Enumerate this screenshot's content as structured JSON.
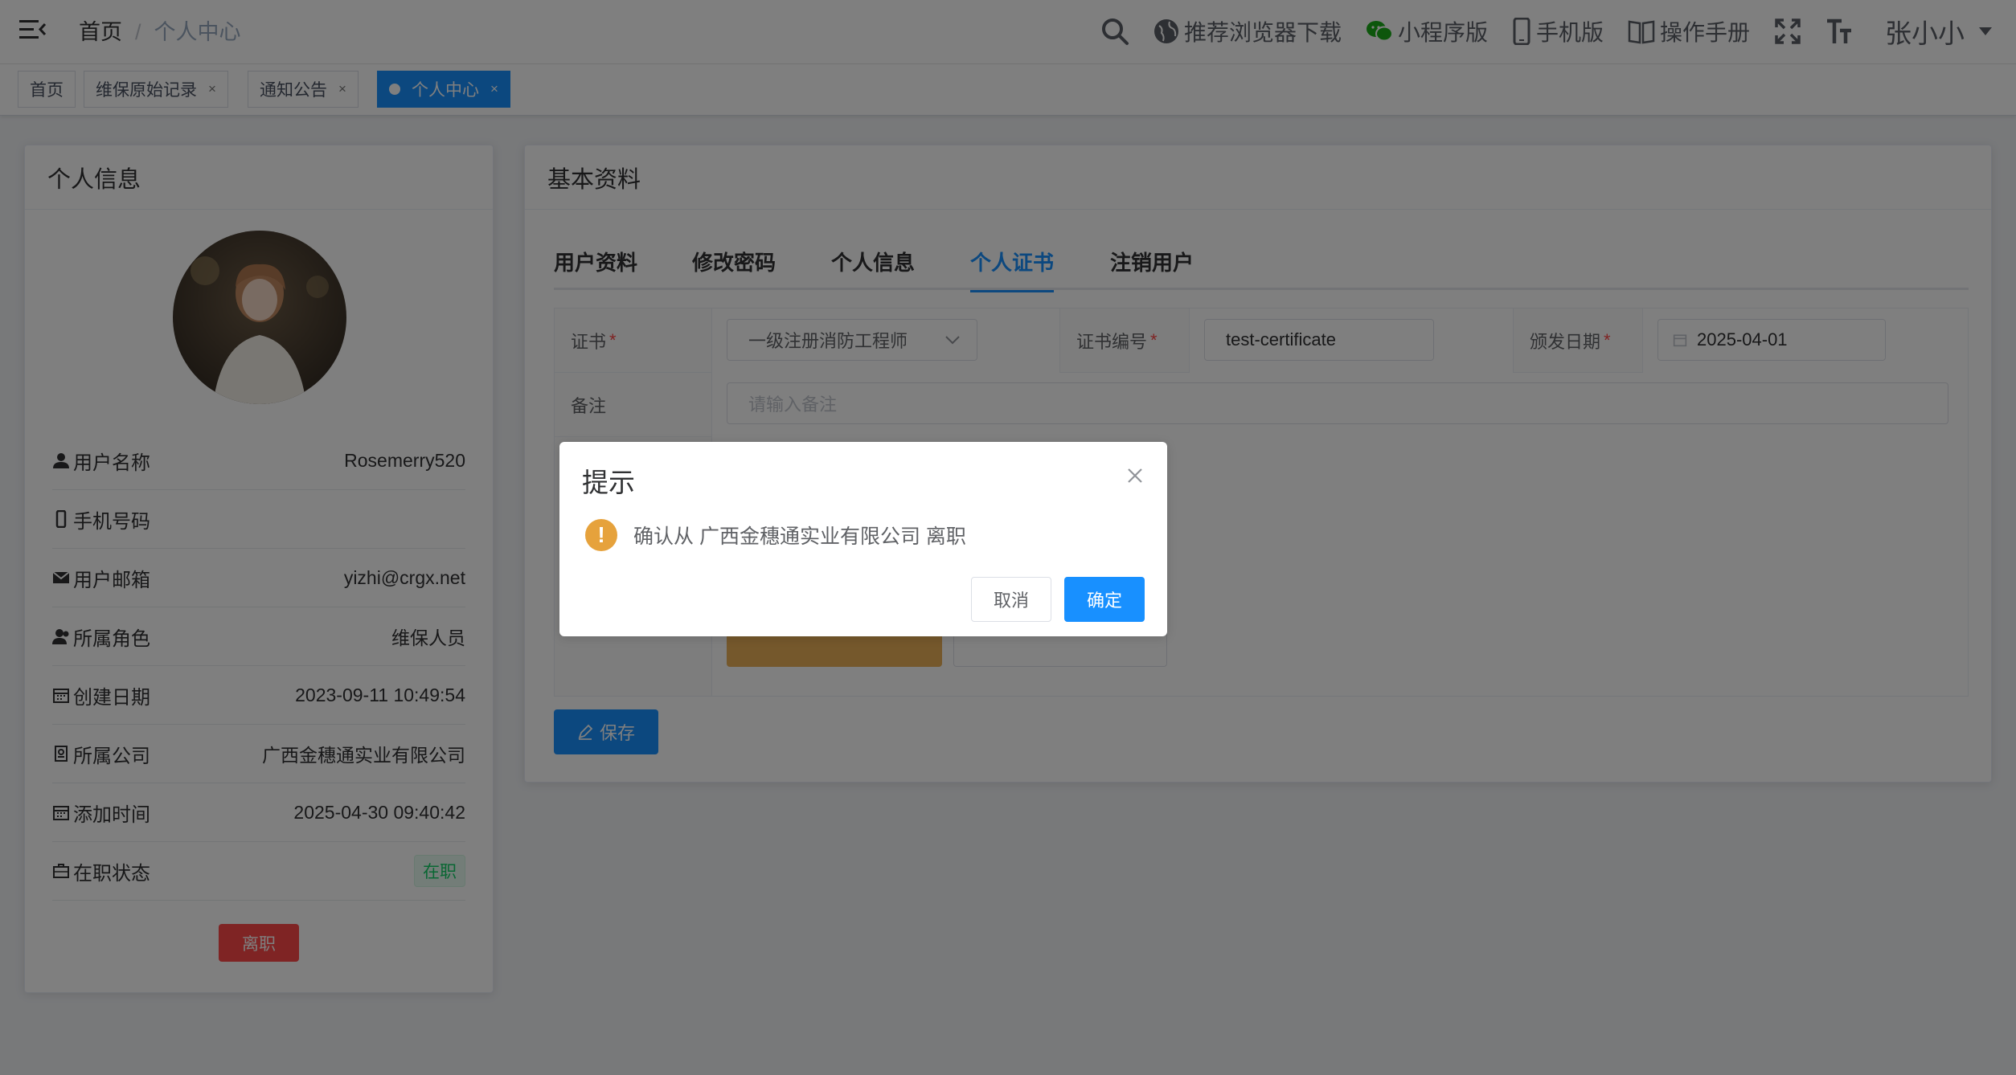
{
  "navbar": {
    "breadcrumb": {
      "home": "首页",
      "separator": "/",
      "current": "个人中心"
    },
    "actions": {
      "browser": "推荐浏览器下载",
      "mini_program": "小程序版",
      "mobile": "手机版",
      "manual": "操作手册"
    },
    "user_name": "张小小"
  },
  "tags": [
    {
      "label": "首页"
    },
    {
      "label": "维保原始记录",
      "close": "×"
    },
    {
      "label": "通知公告",
      "close": "×"
    },
    {
      "label": "个人中心",
      "close": "×",
      "active": true
    }
  ],
  "profile": {
    "title": "个人信息",
    "rows": [
      {
        "label": "用户名称",
        "value": "Rosemerry520",
        "icon": "user-icon"
      },
      {
        "label": "手机号码",
        "value": "",
        "icon": "phone-icon"
      },
      {
        "label": "用户邮箱",
        "value": "yizhi@crgx.net",
        "icon": "mail-icon"
      },
      {
        "label": "所属角色",
        "value": "维保人员",
        "icon": "role-icon"
      },
      {
        "label": "创建日期",
        "value": "2023-09-11 10:49:54",
        "icon": "calendar-icon"
      },
      {
        "label": "所属公司",
        "value": "广西金穗通实业有限公司",
        "icon": "company-icon"
      },
      {
        "label": "添加时间",
        "value": "2025-04-30 09:40:42",
        "icon": "calendar-icon"
      },
      {
        "label": "在职状态",
        "value": "在职",
        "icon": "briefcase-icon"
      }
    ],
    "leave_button": "离职"
  },
  "basic": {
    "title": "基本资料",
    "tabs": [
      "用户资料",
      "修改密码",
      "个人信息",
      "个人证书",
      "注销用户"
    ],
    "active_tab": "个人证书",
    "form": {
      "certificate_label": "证书",
      "certificate_value": "一级注册消防工程师",
      "cert_no_label": "证书编号",
      "cert_no_value": "test-certificate",
      "issue_date_label": "颁发日期",
      "issue_date_value": "2025-04-01",
      "remark_label": "备注",
      "remark_placeholder": "请输入备注",
      "required_mark": "*"
    },
    "save_button": "保存"
  },
  "dialog": {
    "title": "提示",
    "message": "确认从 广西金穗通实业有限公司 离职",
    "cancel": "取消",
    "confirm": "确定"
  },
  "colors": {
    "primary": "#1890ff",
    "danger": "#ff4949",
    "warning": "#e6a23c",
    "success": "#13ce66"
  }
}
